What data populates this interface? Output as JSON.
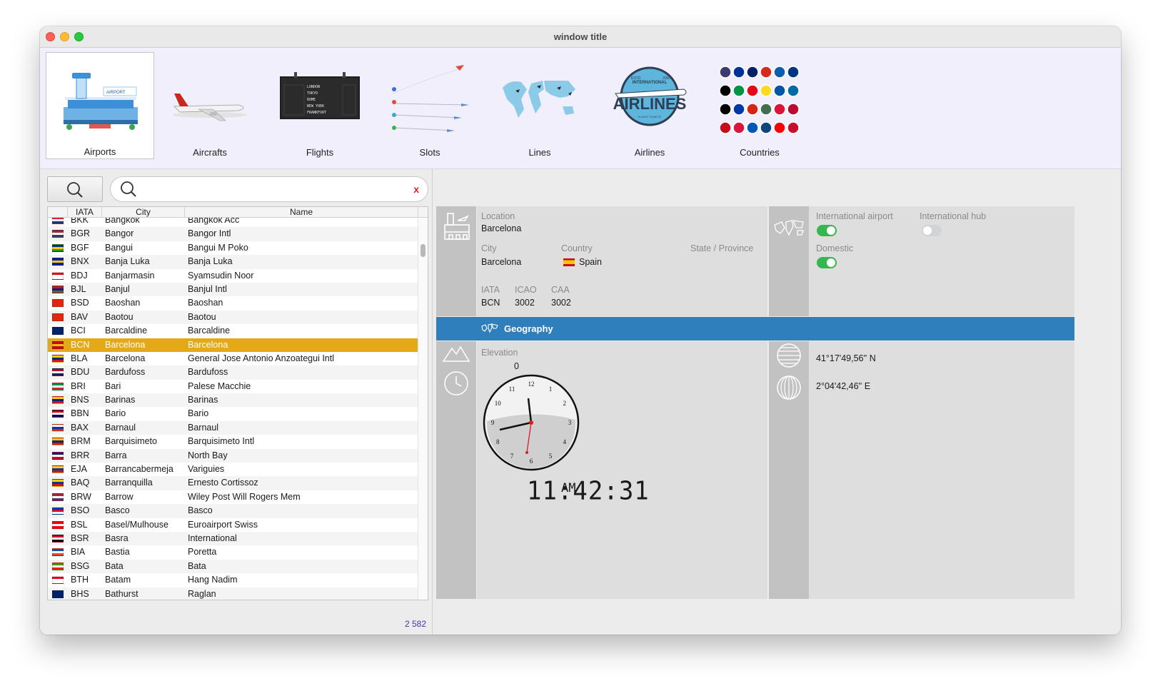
{
  "window": {
    "title": "window title"
  },
  "toolbar": {
    "items": [
      {
        "label": "Airports",
        "icon": "airport-icon"
      },
      {
        "label": "Aircrafts",
        "icon": "aircraft-icon"
      },
      {
        "label": "Flights",
        "icon": "flight-board-icon"
      },
      {
        "label": "Slots",
        "icon": "slots-icon"
      },
      {
        "label": "Lines",
        "icon": "world-map-icon"
      },
      {
        "label": "Airlines",
        "icon": "airlines-badge-icon"
      },
      {
        "label": "Countries",
        "icon": "country-flags-icon"
      }
    ],
    "active": "Airports",
    "flight_board": [
      "LONDON",
      "TOKYO",
      "ROME",
      "NEW YORK",
      "FRANKFURT"
    ],
    "airlines_badge": {
      "top": "INTERNATIONAL",
      "main": "AIRLINES",
      "left": "ESTD",
      "right": "2000",
      "bottom": "FLIGHT TICKETS"
    },
    "airport_sign": "AIRPORT"
  },
  "search": {
    "placeholder": "",
    "value": "",
    "clear_label": "x"
  },
  "table": {
    "columns": [
      "IATA",
      "City",
      "Name"
    ],
    "rows": [
      {
        "iata": "BKK",
        "city": "Bangkok",
        "name": "Bangkok Acc",
        "flag": [
          "#cc2233",
          "#ffffff",
          "#22337a"
        ]
      },
      {
        "iata": "BGR",
        "city": "Bangor",
        "name": "Bangor Intl",
        "flag": [
          "#b22234",
          "#ffffff",
          "#3c3b6e"
        ]
      },
      {
        "iata": "BGF",
        "city": "Bangui",
        "name": "Bangui M Poko",
        "flag": [
          "#003082",
          "#ffce00",
          "#289728"
        ]
      },
      {
        "iata": "BNX",
        "city": "Banja Luka",
        "name": "Banja Luka",
        "flag": [
          "#002395",
          "#fecb00",
          "#002395"
        ]
      },
      {
        "iata": "BDJ",
        "city": "Banjarmasin",
        "name": "Syamsudin Noor",
        "flag": [
          "#e70011",
          "#ffffff",
          "#ffffff"
        ]
      },
      {
        "iata": "BJL",
        "city": "Banjul",
        "name": "Banjul Intl",
        "flag": [
          "#ce1126",
          "#0c1c8c",
          "#3a7728"
        ]
      },
      {
        "iata": "BSD",
        "city": "Baoshan",
        "name": "Baoshan",
        "flag": [
          "#de2910",
          "#de2910",
          "#de2910"
        ]
      },
      {
        "iata": "BAV",
        "city": "Baotou",
        "name": "Baotou",
        "flag": [
          "#de2910",
          "#de2910",
          "#de2910"
        ]
      },
      {
        "iata": "BCI",
        "city": "Barcaldine",
        "name": "Barcaldine",
        "flag": [
          "#012169",
          "#012169",
          "#012169"
        ]
      },
      {
        "iata": "BCN",
        "city": "Barcelona",
        "name": "Barcelona",
        "flag": [
          "#c60b1e",
          "#ffc400",
          "#c60b1e"
        ],
        "selected": true
      },
      {
        "iata": "BLA",
        "city": "Barcelona",
        "name": "General Jose Antonio Anzoategui Intl",
        "flag": [
          "#ffcc00",
          "#00247d",
          "#cf142b"
        ]
      },
      {
        "iata": "BDU",
        "city": "Bardufoss",
        "name": "Bardufoss",
        "flag": [
          "#ba0c2f",
          "#ffffff",
          "#00205b"
        ]
      },
      {
        "iata": "BRI",
        "city": "Bari",
        "name": "Palese Macchie",
        "flag": [
          "#009246",
          "#ffffff",
          "#ce2b37"
        ]
      },
      {
        "iata": "BNS",
        "city": "Barinas",
        "name": "Barinas",
        "flag": [
          "#ffcc00",
          "#00247d",
          "#cf142b"
        ]
      },
      {
        "iata": "BBN",
        "city": "Bario",
        "name": "Bario",
        "flag": [
          "#cc0001",
          "#ffffff",
          "#010066"
        ]
      },
      {
        "iata": "BAX",
        "city": "Barnaul",
        "name": "Barnaul",
        "flag": [
          "#ffffff",
          "#0039a6",
          "#d52b1e"
        ]
      },
      {
        "iata": "BRM",
        "city": "Barquisimeto",
        "name": "Barquisimeto Intl",
        "flag": [
          "#ffcc00",
          "#00247d",
          "#cf142b"
        ]
      },
      {
        "iata": "BRR",
        "city": "Barra",
        "name": "North Bay",
        "flag": [
          "#012169",
          "#ffffff",
          "#c8102e"
        ]
      },
      {
        "iata": "EJA",
        "city": "Barrancabermeja",
        "name": "Variguies",
        "flag": [
          "#fcd116",
          "#003893",
          "#ce1126"
        ]
      },
      {
        "iata": "BAQ",
        "city": "Barranquilla",
        "name": "Ernesto Cortissoz",
        "flag": [
          "#fcd116",
          "#003893",
          "#ce1126"
        ]
      },
      {
        "iata": "BRW",
        "city": "Barrow",
        "name": "Wiley Post Will Rogers Mem",
        "flag": [
          "#b22234",
          "#ffffff",
          "#3c3b6e"
        ]
      },
      {
        "iata": "BSO",
        "city": "Basco",
        "name": "Basco",
        "flag": [
          "#0038a8",
          "#ce1126",
          "#ffffff"
        ]
      },
      {
        "iata": "BSL",
        "city": "Basel/Mulhouse",
        "name": "Euroairport Swiss",
        "flag": [
          "#ff0000",
          "#ffffff",
          "#ff0000"
        ]
      },
      {
        "iata": "BSR",
        "city": "Basra",
        "name": "International",
        "flag": [
          "#ce1126",
          "#ffffff",
          "#000000"
        ]
      },
      {
        "iata": "BIA",
        "city": "Bastia",
        "name": "Poretta",
        "flag": [
          "#0055a4",
          "#ffffff",
          "#ef4135"
        ]
      },
      {
        "iata": "BSG",
        "city": "Bata",
        "name": "Bata",
        "flag": [
          "#3e9a00",
          "#ffffff",
          "#e32118"
        ]
      },
      {
        "iata": "BTH",
        "city": "Batam",
        "name": "Hang Nadim",
        "flag": [
          "#e70011",
          "#ffffff",
          "#ffffff"
        ]
      },
      {
        "iata": "BHS",
        "city": "Bathurst",
        "name": "Raglan",
        "flag": [
          "#012169",
          "#012169",
          "#012169"
        ]
      }
    ],
    "count": "2 582"
  },
  "detail": {
    "location_label": "Location",
    "location_value": "Barcelona",
    "city_label": "City",
    "city_value": "Barcelona",
    "country_label": "Country",
    "country_value": "Spain",
    "state_label": "State / Province",
    "iata_label": "IATA",
    "iata_value": "BCN",
    "icao_label": "ICAO",
    "icao_value": "3002",
    "caa_label": "CAA",
    "caa_value": "3002",
    "intl_airport_label": "International airport",
    "intl_airport_on": true,
    "intl_hub_label": "International hub",
    "intl_hub_on": false,
    "domestic_label": "Domestic",
    "domestic_on": true
  },
  "geography": {
    "title": "Geography",
    "elevation_label": "Elevation",
    "elevation_value": "0",
    "latitude": "41°17'49,56'' N",
    "longitude": "2°04'42,46'' E",
    "clock_digital": "11:42:31",
    "clock_ampm": "AM",
    "clock_numbers": [
      "12",
      "1",
      "2",
      "3",
      "4",
      "5",
      "6",
      "7",
      "8",
      "9",
      "10",
      "11"
    ]
  },
  "colors": {
    "selected_row": "#e3aa18",
    "section_bar": "#2f7fbd",
    "toggle_on": "#32b84f"
  }
}
